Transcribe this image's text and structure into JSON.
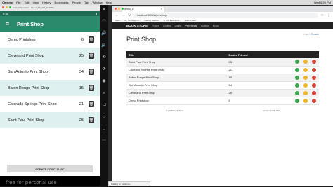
{
  "mac_menu": {
    "app": "Chrome",
    "items": [
      "File",
      "Edit",
      "View",
      "History",
      "Bookmarks",
      "People",
      "Tab",
      "Window",
      "Help"
    ],
    "clock": "Wed 6:35 PM"
  },
  "emulator": {
    "title": "Android Emulator - Nexus_5X_API_26:5554",
    "status_time": "6:35",
    "app_title": "Print Shop",
    "list": [
      {
        "name": "Demo Printshop",
        "count": "6"
      },
      {
        "name": "Cleveland Print Shop",
        "count": "25"
      },
      {
        "name": "San Antonio Print Shop",
        "count": "34"
      },
      {
        "name": "Baton Rouge Print Shop",
        "count": "15"
      },
      {
        "name": "Colorado Springs Print Shop",
        "count": "21"
      },
      {
        "name": "Saint Paul Print Shop",
        "count": "25"
      }
    ],
    "create_label": "CREATE PRINT SHOP",
    "watermark": "free for personal use"
  },
  "browser": {
    "tab_title": "demo_ui",
    "url": "localhost:3000/#!/printshop",
    "bookmarks": [
      "Apps",
      "Top Ten Ways to...",
      "Getting Started...",
      "UTSA Developm...",
      "peer-to-peer..."
    ],
    "site_nav": [
      "Store",
      "Charts",
      "Login",
      "PrintShop",
      "Author",
      "Book"
    ],
    "brand": "BOOK STORE",
    "breadcrumb_text": "List",
    "breadcrumb_link": "Create",
    "heading": "Print Shop",
    "table": {
      "headers": [
        "Title",
        "Books Printed"
      ],
      "rows": [
        [
          "Saint Paul Print Shop",
          "25"
        ],
        [
          "Colorado Springs Print Shop",
          "21"
        ],
        [
          "Baton Rouge Print Shop",
          "15"
        ],
        [
          "San Antonio Print Shop",
          "34"
        ],
        [
          "Cleveland Print Shop",
          "25"
        ],
        [
          "Demo Printshop",
          "6"
        ]
      ]
    },
    "footer_left": "© 2018 Book Store",
    "footer_right": "version 0.000.002",
    "status_text": "Waiting for localhost..."
  },
  "colors": {
    "green": "#2a8a6b",
    "view_btn": "#3aa84a",
    "edit_btn": "#f0b528",
    "delete_btn": "#d9453a"
  }
}
